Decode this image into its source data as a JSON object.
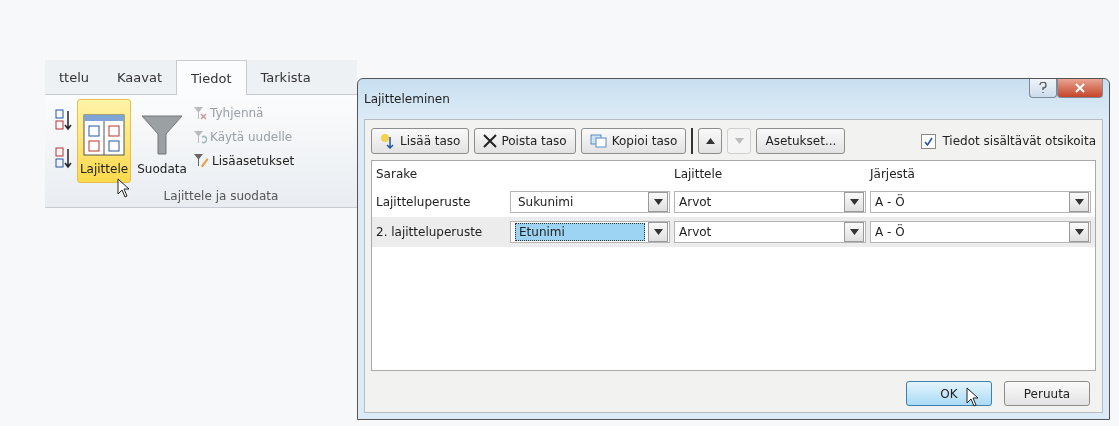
{
  "ribbon": {
    "tabs": [
      {
        "label": "ttelu",
        "selected": false
      },
      {
        "label": "Kaavat",
        "selected": false
      },
      {
        "label": "Tiedot",
        "selected": true
      },
      {
        "label": "Tarkista",
        "selected": false
      }
    ],
    "sort_buttons": [
      {
        "kind": "az"
      },
      {
        "kind": "za"
      }
    ],
    "large_buttons": [
      {
        "label": "Lajittele",
        "kind": "sort",
        "highlighted": true
      },
      {
        "label": "Suodata",
        "kind": "filter",
        "highlighted": false
      }
    ],
    "small_buttons": [
      {
        "label": "Tyhjennä",
        "kind": "clear",
        "disabled": true
      },
      {
        "label": "Käytä uudelle",
        "kind": "reapply",
        "disabled": true
      },
      {
        "label": "Lisäasetukset",
        "kind": "advanced",
        "disabled": false
      }
    ],
    "group_label": "Lajittele ja suodata"
  },
  "dialog": {
    "title": "Lajitteleminen",
    "toolbar": [
      {
        "label": "Lisää taso",
        "kind": "add"
      },
      {
        "label": "Poista taso",
        "kind": "delete"
      },
      {
        "label": "Kopioi taso",
        "kind": "copy"
      }
    ],
    "move_buttons": [
      {
        "kind": "up",
        "disabled": false
      },
      {
        "kind": "down",
        "disabled": true
      }
    ],
    "options_button": "Asetukset...",
    "headers_checkbox": {
      "label": "Tiedot sisältävät otsikoita",
      "checked": true
    },
    "columns": [
      "Sarake",
      "Lajittele",
      "Järjestä"
    ],
    "rows": [
      {
        "label": "Lajitteluperuste",
        "column": "Sukunimi",
        "sort_on": "Arvot",
        "order": "A - Ö",
        "selected": false
      },
      {
        "label": "2. lajitteluperuste",
        "column": "Etunimi",
        "sort_on": "Arvot",
        "order": "A - Ö",
        "selected": true
      }
    ],
    "buttons": [
      {
        "label": "OK",
        "default": true
      },
      {
        "label": "Peruuta",
        "default": false
      }
    ]
  }
}
